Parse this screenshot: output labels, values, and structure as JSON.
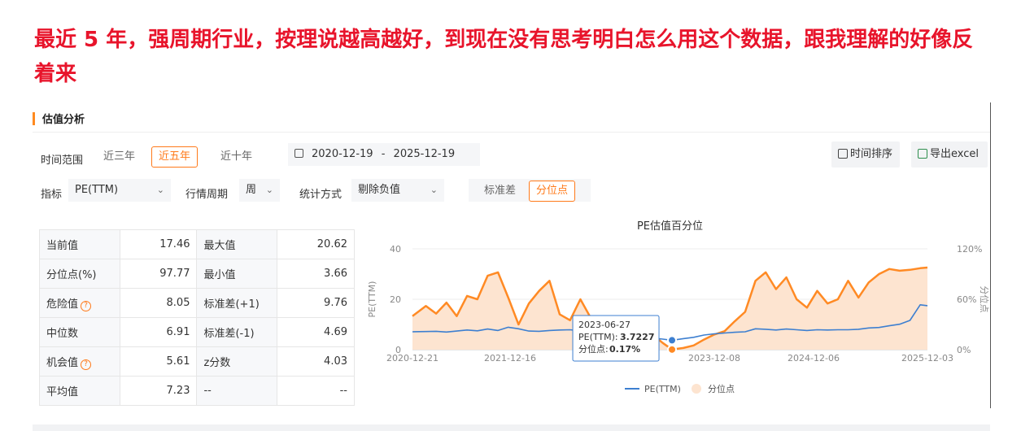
{
  "caption": "最近 5 年，强周期行业，按理说越高越好，到现在没有思考明白怎么用这个数据，跟我理解的好像反着来",
  "panel": {
    "title": "估值分析"
  },
  "time_range": {
    "label": "时间范围",
    "options": [
      "近三年",
      "近五年",
      "近十年"
    ],
    "selected": "近五年",
    "date_start": "2020-12-19",
    "date_sep": "-",
    "date_end": "2025-12-19"
  },
  "toolbar": {
    "sort_label": "时间排序",
    "export_label": "导出excel"
  },
  "filters": {
    "metric_label": "指标",
    "metric_value": "PE(TTM)",
    "period_label": "行情周期",
    "period_value": "周",
    "stat_label": "统计方式",
    "stat_value": "剔除负值",
    "mode_options": [
      "标准差",
      "分位点"
    ],
    "mode_selected": "分位点"
  },
  "stats": {
    "rows": [
      {
        "k1": "当前值",
        "v1": "17.46",
        "k2": "最大值",
        "v2": "20.62",
        "help1": false
      },
      {
        "k1": "分位点(%)",
        "v1": "97.77",
        "k2": "最小值",
        "v2": "3.66",
        "help1": false
      },
      {
        "k1": "危险值",
        "v1": "8.05",
        "k2": "标准差(+1)",
        "v2": "9.76",
        "help1": true
      },
      {
        "k1": "中位数",
        "v1": "6.91",
        "k2": "标准差(-1)",
        "v2": "4.69",
        "help1": false
      },
      {
        "k1": "机会值",
        "v1": "5.61",
        "k2": "z分数",
        "v2": "4.03",
        "help1": true
      },
      {
        "k1": "平均值",
        "v1": "7.23",
        "k2": "--",
        "v2": "--",
        "help1": false
      }
    ],
    "help_glyph": "?"
  },
  "chart_data": {
    "type": "line",
    "title": "PE估值百分位",
    "ylabel_left": "PE(TTM)",
    "ylabel_right": "分位点",
    "y_left_ticks": [
      "0",
      "20",
      "40"
    ],
    "y_left_range": [
      0,
      40
    ],
    "y_right_ticks": [
      "0%",
      "60%",
      "120%"
    ],
    "y_right_range": [
      0,
      120
    ],
    "x_ticks": [
      "2020-12-21",
      "2021-12-16",
      "2023-12-08",
      "2024-12-06",
      "2025-12-03"
    ],
    "x": [
      2020.97,
      2021.1,
      2021.2,
      2021.3,
      2021.4,
      2021.5,
      2021.6,
      2021.7,
      2021.8,
      2021.9,
      2022.0,
      2022.1,
      2022.2,
      2022.3,
      2022.4,
      2022.5,
      2022.6,
      2022.7,
      2022.8,
      2022.9,
      2023.0,
      2023.1,
      2023.2,
      2023.3,
      2023.4,
      2023.49,
      2023.6,
      2023.7,
      2023.8,
      2023.9,
      2024.0,
      2024.1,
      2024.2,
      2024.3,
      2024.4,
      2024.5,
      2024.6,
      2024.7,
      2024.8,
      2024.9,
      2025.0,
      2025.1,
      2025.2,
      2025.3,
      2025.4,
      2025.5,
      2025.6,
      2025.7,
      2025.8,
      2025.9,
      2025.97
    ],
    "series": [
      {
        "name": "PE(TTM)",
        "color": "#3d7fd0",
        "values": [
          7.1,
          7.2,
          7.3,
          7.0,
          7.4,
          7.8,
          7.5,
          8.2,
          7.6,
          8.9,
          8.3,
          7.4,
          7.3,
          7.6,
          7.8,
          7.9,
          7.5,
          7.0,
          7.2,
          6.7,
          6.6,
          5.6,
          4.9,
          4.6,
          4.2,
          3.73,
          4.4,
          4.9,
          5.8,
          6.3,
          6.6,
          6.9,
          7.1,
          8.3,
          8.1,
          7.8,
          8.2,
          7.9,
          7.6,
          7.9,
          7.8,
          7.9,
          7.9,
          8.1,
          8.6,
          8.8,
          9.5,
          10.1,
          11.6,
          17.8,
          17.46
        ]
      },
      {
        "name": "分位点",
        "color": "#ff8a24",
        "fill": "#fde4d0",
        "values": [
          40,
          52,
          43,
          56,
          40,
          64,
          60,
          88,
          92,
          62,
          30,
          55,
          70,
          82,
          42,
          35,
          60,
          38,
          30,
          33,
          30,
          20,
          12,
          18,
          8,
          0.17,
          2,
          5,
          12,
          18,
          22,
          34,
          45,
          82,
          92,
          72,
          86,
          60,
          50,
          70,
          55,
          60,
          82,
          62,
          80,
          90,
          96,
          94,
          95,
          97,
          97.77
        ]
      }
    ],
    "tooltip": {
      "date": "2023-06-27",
      "pe_label": "PE(TTM):",
      "pe_value": "3.7227",
      "pct_label": "分位点:",
      "pct_value": "0.17%",
      "x": 2023.49
    },
    "legend": [
      "PE(TTM)",
      "分位点"
    ],
    "legend_position": "bottom"
  },
  "colors": {
    "accent": "#ff7a1a",
    "caption": "#e8142b",
    "line": "#3d7fd0",
    "area": "#ff8a24"
  }
}
